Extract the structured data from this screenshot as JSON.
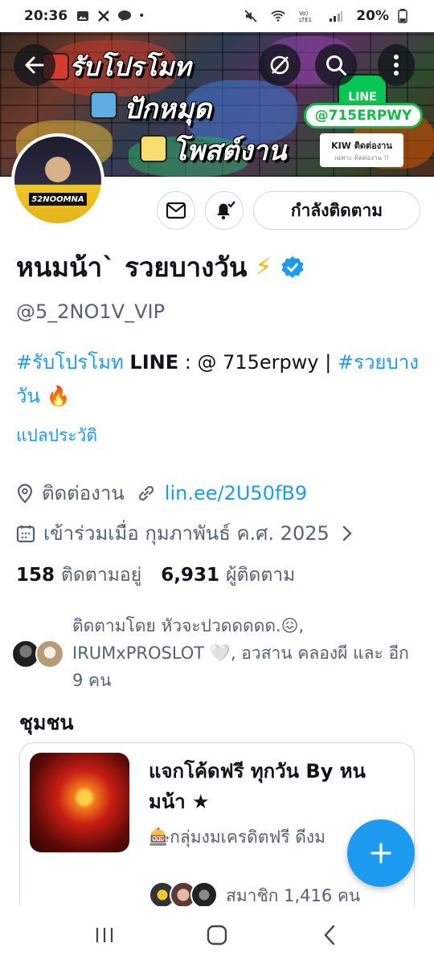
{
  "status_bar": {
    "time": "20:36",
    "dot": "•",
    "battery": "20%",
    "icons": [
      "gallery-icon",
      "x-app-icon",
      "line-app-icon",
      "mute-icon",
      "wifi-icon",
      "volte-icon",
      "signal-icon",
      "battery-icon"
    ]
  },
  "banner": {
    "line1": "รับโปรโมท",
    "line2": "ปักหมุด",
    "line3": "โพสต์งาน",
    "line_logo": "LINE",
    "promo_tag": "@715ERPWY",
    "kiw_title": "KIW ติดต่องาน",
    "kiw_sub": "เฉพาะ ติดต่องาน !!",
    "avatar_label": "52NOOMNA"
  },
  "actions": {
    "follow_label": "กำลังติดตาม"
  },
  "profile": {
    "name": "หนมน้า` รวยบางวัน",
    "name_emoji": "⚡",
    "handle": "@5_2NO1V_VIP",
    "bio_hash1": "#รับโปรโมท",
    "bio_line_word": "LINE",
    "bio_mid": " : @ 715erpwy | ",
    "bio_hash2": "#รวยบางวัน",
    "bio_emoji": "🔥",
    "translate_label": "แปลประวัติ",
    "location": "ติดต่องาน",
    "link": "lin.ee/2U50fB9",
    "joined": "เข้าร่วมเมื่อ กุมภาพันธ์ ค.ศ. 2025",
    "following_count": "158",
    "following_label": "ติดตามอยู่",
    "followers_count": "6,931",
    "followers_label": "ผู้ติดตาม",
    "followed_by": "ติดตามโดย หัวจะปวดดดดด.😖, IRUMxPROSLOT 🤍, อวสาน คลองผี และ อีก 9 คน"
  },
  "community": {
    "section_title": "ชุมชน",
    "name": "แจกโค้ดฟรี ทุกวัน By หนมน้า ★",
    "description": "🎰กลุ่มงมเครดิตฟรี ดีงม",
    "members": "สมาชิก 1,416 คน"
  },
  "colors": {
    "accent": "#1d9bf0",
    "text": "#0f1419",
    "muted": "#536471",
    "border": "#cfd9de",
    "line_green": "#06c755"
  }
}
